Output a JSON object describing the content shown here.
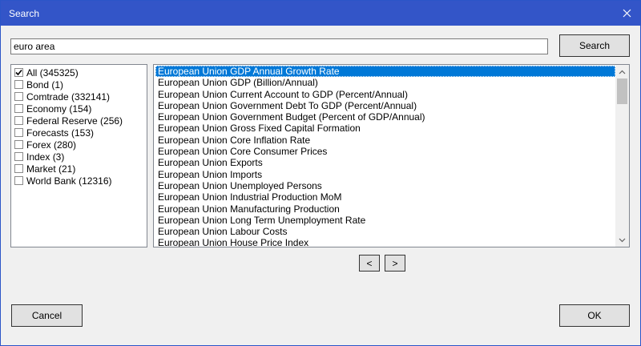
{
  "window": {
    "title": "Search"
  },
  "search": {
    "value": "euro area",
    "button_label": "Search"
  },
  "categories": [
    {
      "label": "All  (345325)",
      "checked": true
    },
    {
      "label": "Bond  (1)",
      "checked": false
    },
    {
      "label": "Comtrade  (332141)",
      "checked": false
    },
    {
      "label": "Economy  (154)",
      "checked": false
    },
    {
      "label": "Federal Reserve  (256)",
      "checked": false
    },
    {
      "label": "Forecasts  (153)",
      "checked": false
    },
    {
      "label": "Forex  (280)",
      "checked": false
    },
    {
      "label": "Index  (3)",
      "checked": false
    },
    {
      "label": "Market  (21)",
      "checked": false
    },
    {
      "label": "World Bank  (12316)",
      "checked": false
    }
  ],
  "results": [
    {
      "label": "European Union GDP Annual Growth Rate",
      "selected": true
    },
    {
      "label": "European Union GDP  (Billion/Annual)"
    },
    {
      "label": "European Union Current Account to GDP  (Percent/Annual)"
    },
    {
      "label": "European Union Government Debt To GDP  (Percent/Annual)"
    },
    {
      "label": "European Union Government Budget  (Percent of GDP/Annual)"
    },
    {
      "label": "European Union Gross Fixed Capital Formation"
    },
    {
      "label": "European Union Core Inflation Rate"
    },
    {
      "label": "European Union Core Consumer Prices"
    },
    {
      "label": "European Union Exports"
    },
    {
      "label": "European Union Imports"
    },
    {
      "label": "European Union Unemployed Persons"
    },
    {
      "label": "European Union Industrial Production MoM"
    },
    {
      "label": "European Union Manufacturing Production"
    },
    {
      "label": "European Union Long Term Unemployment Rate"
    },
    {
      "label": "European Union Labour Costs"
    },
    {
      "label": "European Union House Price Index"
    }
  ],
  "pager": {
    "prev_label": "<",
    "next_label": ">"
  },
  "footer": {
    "cancel_label": "Cancel",
    "ok_label": "OK"
  },
  "icons": {
    "close": "close-icon",
    "check": "checkmark-icon",
    "scroll_up": "chevron-up-icon",
    "scroll_down": "chevron-down-icon"
  },
  "colors": {
    "titlebar": "#3355c8",
    "selection": "#0078d7"
  }
}
